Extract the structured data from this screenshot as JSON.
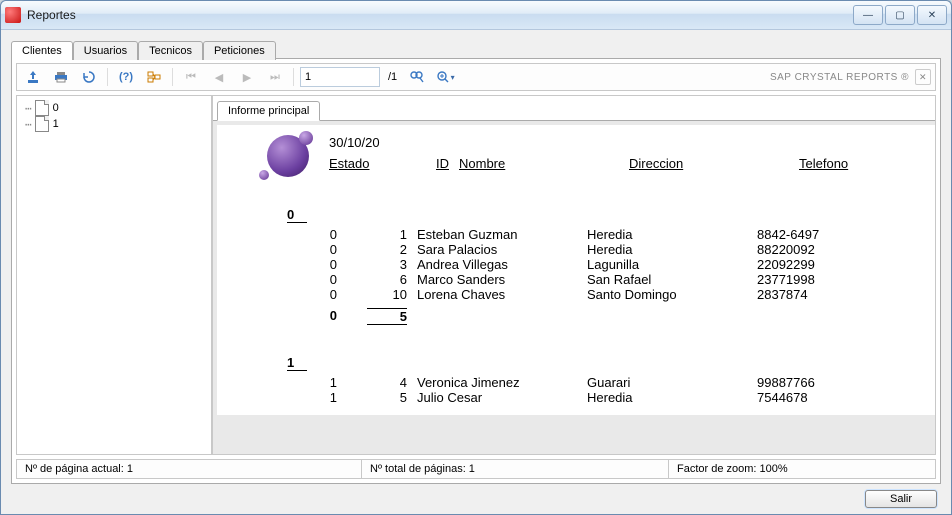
{
  "window": {
    "title": "Reportes"
  },
  "tabs": {
    "clientes": "Clientes",
    "usuarios": "Usuarios",
    "tecnicos": "Tecnicos",
    "peticiones": "Peticiones"
  },
  "tree": {
    "items": [
      "0",
      "1"
    ]
  },
  "toolbar": {
    "page_input": "1",
    "page_sep": "/1",
    "brand": "SAP CRYSTAL REPORTS ®"
  },
  "inner_tab": "Informe principal",
  "report": {
    "date": "30/10/20",
    "headers": {
      "estado": "Estado",
      "id": "ID",
      "nombre": "Nombre",
      "direccion": "Direccion",
      "telefono": "Telefono"
    },
    "groups": [
      {
        "label": "0",
        "rows": [
          {
            "estado": "0",
            "id": "1",
            "nombre": "Esteban Guzman",
            "direccion": "Heredia",
            "telefono": "8842-6497"
          },
          {
            "estado": "0",
            "id": "2",
            "nombre": "Sara Palacios",
            "direccion": "Heredia",
            "telefono": "88220092"
          },
          {
            "estado": "0",
            "id": "3",
            "nombre": "Andrea Villegas",
            "direccion": "Lagunilla",
            "telefono": "22092299"
          },
          {
            "estado": "0",
            "id": "6",
            "nombre": "Marco Sanders",
            "direccion": "San Rafael",
            "telefono": "23771998"
          },
          {
            "estado": "0",
            "id": "10",
            "nombre": "Lorena Chaves",
            "direccion": "Santo Domingo",
            "telefono": "2837874"
          }
        ],
        "subtotal": {
          "estado": "0",
          "count": "5"
        }
      },
      {
        "label": "1",
        "rows": [
          {
            "estado": "1",
            "id": "4",
            "nombre": "Veronica Jimenez",
            "direccion": "Guarari",
            "telefono": "99887766"
          },
          {
            "estado": "1",
            "id": "5",
            "nombre": "Julio Cesar",
            "direccion": "Heredia",
            "telefono": "7544678"
          }
        ]
      }
    ]
  },
  "status": {
    "current_page": "Nº de página actual: 1",
    "total_pages": "Nº total de páginas: 1",
    "zoom": "Factor de zoom: 100%"
  },
  "buttons": {
    "salir": "Salir"
  }
}
